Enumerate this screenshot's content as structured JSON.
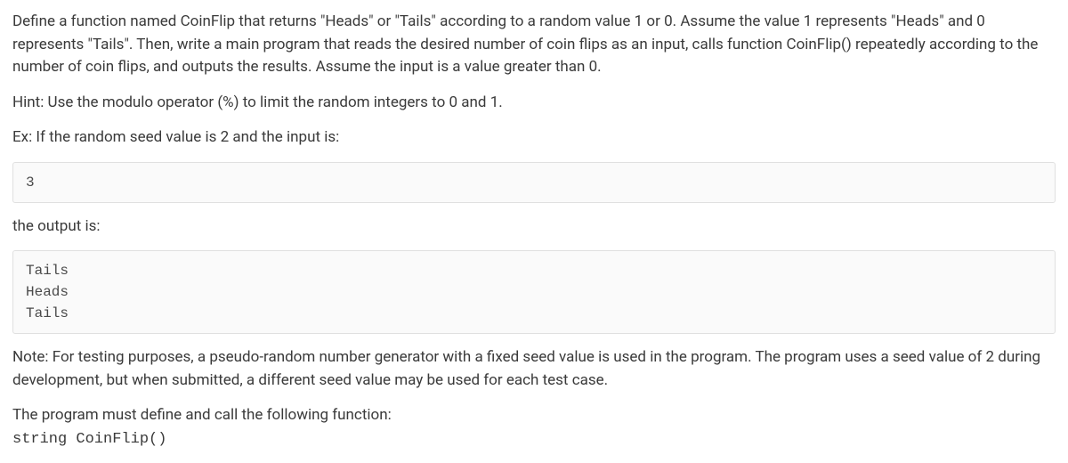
{
  "para1": "Define a function named CoinFlip that returns \"Heads\" or \"Tails\" according to a random value 1 or 0. Assume the value 1 represents \"Heads\" and 0 represents \"Tails\". Then, write a main program that reads the desired number of coin flips as an input, calls function CoinFlip() repeatedly according to the number of coin flips, and outputs the results. Assume the input is a value greater than 0.",
  "hint": "Hint: Use the modulo operator (%) to limit the random integers to 0 and 1.",
  "ex_intro": "Ex: If the random seed value is 2 and the input is:",
  "input_box": "3",
  "output_label": "the output is:",
  "output_box": "Tails\nHeads\nTails",
  "note": "Note: For testing purposes, a pseudo-random number generator with a fixed seed value is used in the program. The program uses a seed value of 2 during development, but when submitted, a different seed value may be used for each test case.",
  "sig_intro": "The program must define and call the following function:",
  "sig_code": "string CoinFlip()"
}
